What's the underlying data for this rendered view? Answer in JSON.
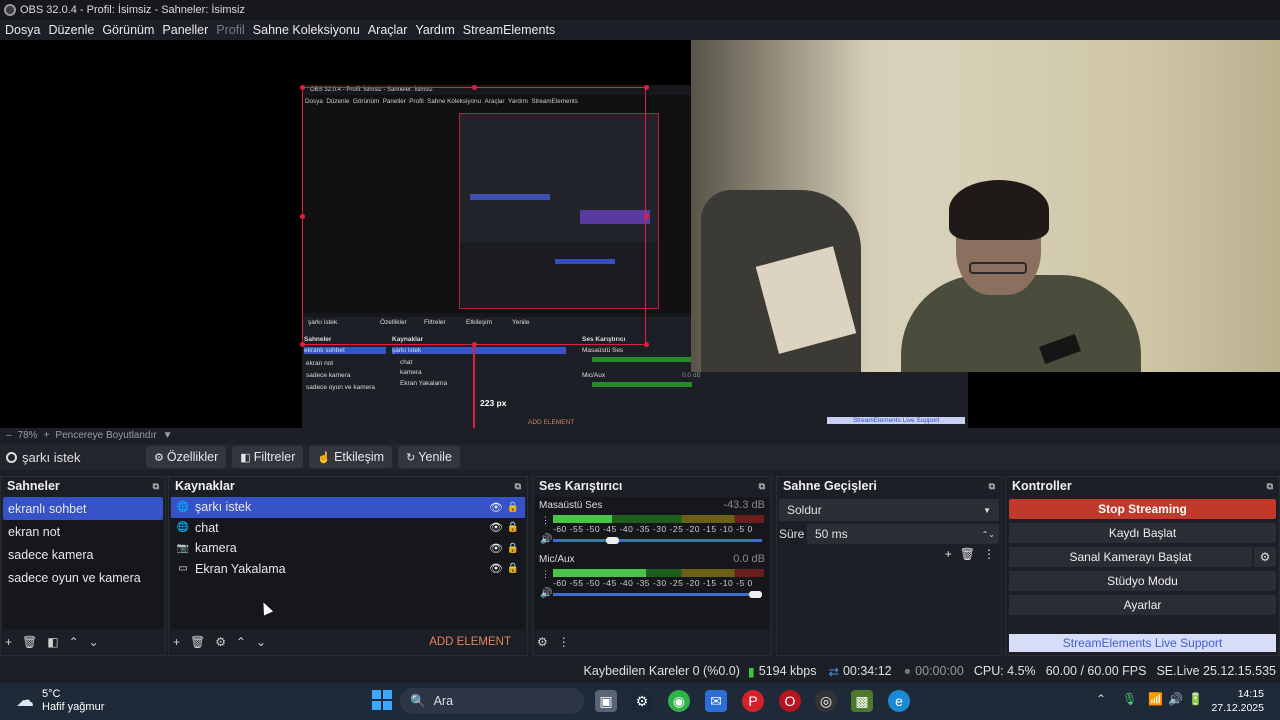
{
  "window": {
    "title": "OBS 32.0.4 - Profil: İsimsiz - Sahneler: İsimsiz"
  },
  "menu": [
    "Dosya",
    "Düzenle",
    "Görünüm",
    "Paneller",
    "Profil",
    "Sahne Koleksiyonu",
    "Araçlar",
    "Yardım",
    "StreamElements"
  ],
  "preview": {
    "size_label": "223 px"
  },
  "zoom": {
    "collapse": "–",
    "level": "78%",
    "plus": "+",
    "fit_label": "Pencereye Boyutlandır",
    "caret": "▼"
  },
  "source_toolbar": {
    "current": "şarkı istek",
    "buttons": [
      "Özellikler",
      "Filtreler",
      "Etkileşim",
      "Yenile"
    ]
  },
  "scenes": {
    "title": "Sahneler",
    "items": [
      "ekranlı sohbet",
      "ekran not",
      "sadece kamera",
      "sadece oyun ve kamera"
    ],
    "selected_index": 0
  },
  "sources": {
    "title": "Kaynaklar",
    "items": [
      {
        "name": "şarkı istek",
        "icon": "globe-icon"
      },
      {
        "name": "chat",
        "icon": "globe-icon"
      },
      {
        "name": "kamera",
        "icon": "camera-icon"
      },
      {
        "name": "Ekran Yakalama",
        "icon": "monitor-icon"
      }
    ],
    "selected_index": 0,
    "add_element": "ADD ELEMENT"
  },
  "mixer": {
    "title": "Ses Karıştırıcı",
    "scale": "-60 -55 -50 -45 -40 -35 -30 -25 -20 -15 -10 -5 0",
    "channels": [
      {
        "name": "Masaüstü Ses",
        "db": "-43.3 dB",
        "level": 0.28,
        "volume": 0.27
      },
      {
        "name": "Mic/Aux",
        "db": "0.0 dB",
        "level": 0.44,
        "volume": 1.0
      }
    ]
  },
  "transitions": {
    "title": "Sahne Geçişleri",
    "selected": "Soldur",
    "duration_label": "Süre",
    "duration_value": "50 ms"
  },
  "controls": {
    "title": "Kontroller",
    "buttons": [
      "Stop Streaming",
      "Kaydı Başlat",
      "Sanal Kamerayı Başlat",
      "Stüdyo Modu",
      "Ayarlar"
    ],
    "support": "StreamElements Live Support"
  },
  "status": {
    "dropped": "Kaybedilen Kareler 0 (%0.0)",
    "bitrate": "5194 kbps",
    "stream_time": "00:34:12",
    "rec_time": "00:00:00",
    "cpu": "CPU: 4.5%",
    "fps": "60.00 / 60.00 FPS",
    "version": "SE.Live 25.12.15.535"
  },
  "taskbar": {
    "weather_temp": "5°C",
    "weather_desc": "Hafif yağmur",
    "search": "Ara",
    "time": "14:15",
    "date": "27.12.2025"
  },
  "colors": {
    "accent": "#3552c7",
    "stop": "#c0392b",
    "support": "#d7dcf7"
  }
}
